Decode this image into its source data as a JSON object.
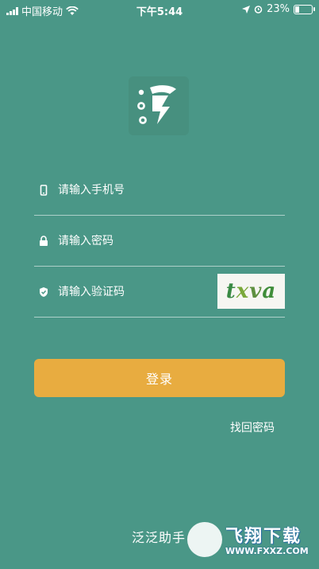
{
  "status_bar": {
    "carrier": "中国移动",
    "time": "下午5:44",
    "battery": "23%"
  },
  "logo": {
    "name": "app-logo-icon"
  },
  "form": {
    "phone_placeholder": "请输入手机号",
    "password_placeholder": "请输入密码",
    "code_placeholder": "请输入验证码",
    "captcha_text": [
      "t",
      "x",
      "v",
      "a"
    ],
    "login_label": "登录",
    "forgot_label": "找回密码"
  },
  "footer": {
    "app_name": "泛泛助手"
  },
  "watermark": {
    "title": "飞翔下载",
    "url": "WWW.FXXZ.COM"
  },
  "colors": {
    "background": "#4a9787",
    "button": "#e8ac40"
  }
}
